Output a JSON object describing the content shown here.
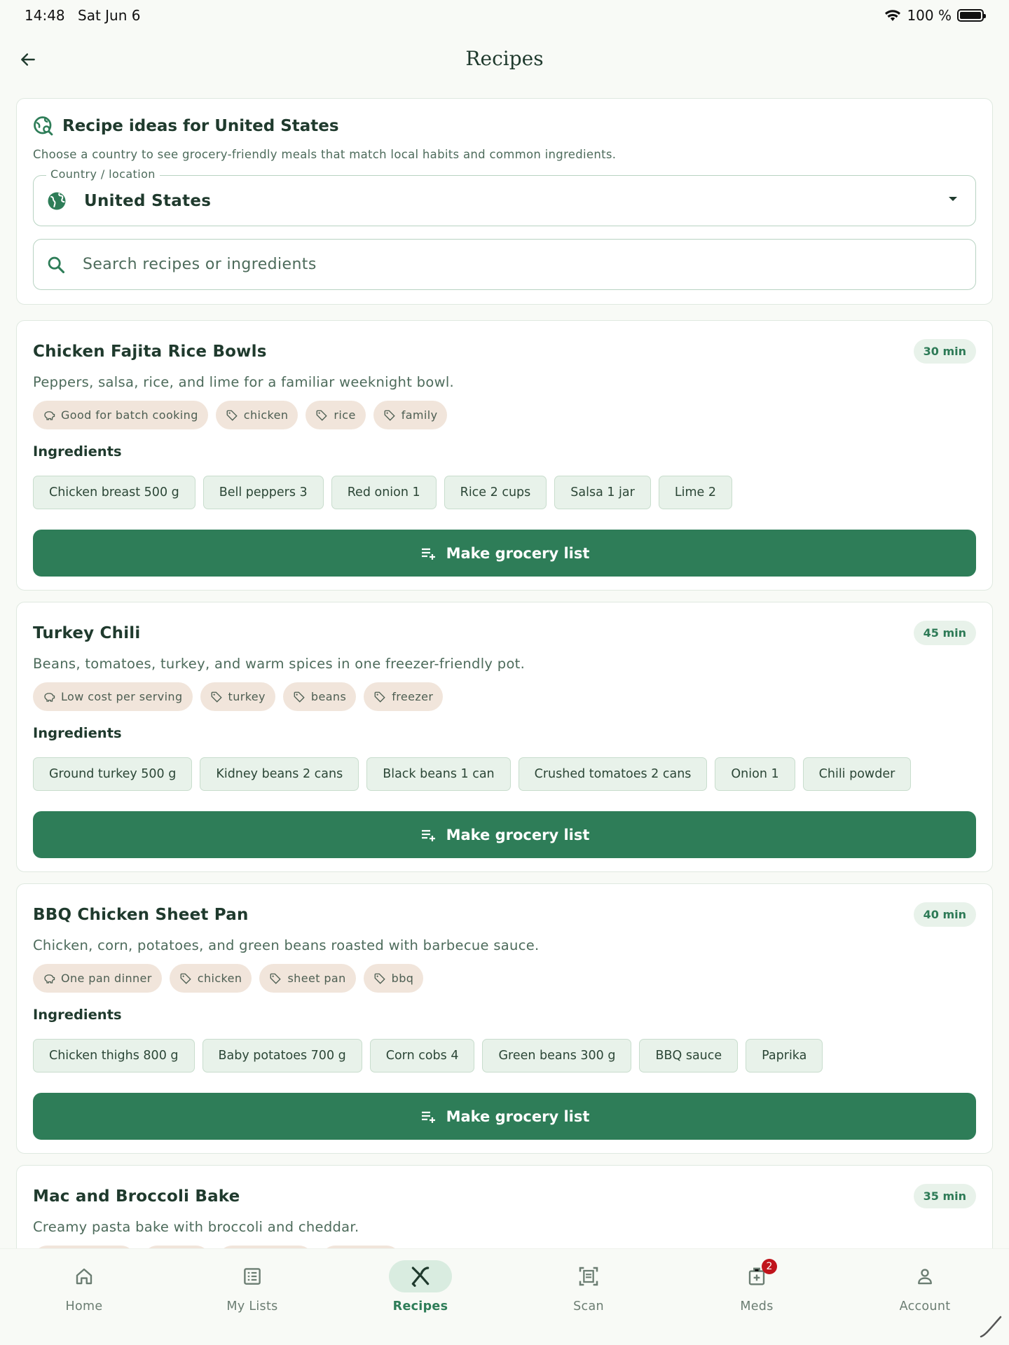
{
  "status": {
    "time": "14:48",
    "date": "Sat Jun 6",
    "battery": "100 %"
  },
  "header": {
    "title": "Recipes"
  },
  "intro": {
    "title": "Recipe ideas for United States",
    "description": "Choose a country to see grocery-friendly meals that match local habits and common ingredients.",
    "country_label": "Country / location",
    "country_value": "United States",
    "search_placeholder": "Search recipes or ingredients"
  },
  "recipes": [
    {
      "title": "Chicken Fajita Rice Bowls",
      "time": "30 min",
      "description": "Peppers, salsa, rice, and lime for a familiar weeknight bowl.",
      "highlight": "Good for batch cooking",
      "tags": [
        "chicken",
        "rice",
        "family"
      ],
      "ingredients_label": "Ingredients",
      "ingredients": [
        "Chicken breast 500 g",
        "Bell peppers 3",
        "Red onion 1",
        "Rice 2 cups",
        "Salsa 1 jar",
        "Lime 2"
      ],
      "button": "Make grocery list"
    },
    {
      "title": "Turkey Chili",
      "time": "45 min",
      "description": "Beans, tomatoes, turkey, and warm spices in one freezer-friendly pot.",
      "highlight": "Low cost per serving",
      "tags": [
        "turkey",
        "beans",
        "freezer"
      ],
      "ingredients_label": "Ingredients",
      "ingredients": [
        "Ground turkey 500 g",
        "Kidney beans 2 cans",
        "Black beans 1 can",
        "Crushed tomatoes 2 cans",
        "Onion 1",
        "Chili powder"
      ],
      "button": "Make grocery list"
    },
    {
      "title": "BBQ Chicken Sheet Pan",
      "time": "40 min",
      "description": "Chicken, corn, potatoes, and green beans roasted with barbecue sauce.",
      "highlight": "One pan dinner",
      "tags": [
        "chicken",
        "sheet pan",
        "bbq"
      ],
      "ingredients_label": "Ingredients",
      "ingredients": [
        "Chicken thighs 800 g",
        "Baby potatoes 700 g",
        "Corn cobs 4",
        "Green beans 300 g",
        "BBQ sauce",
        "Paprika"
      ],
      "button": "Make grocery list"
    },
    {
      "title": "Mac and Broccoli Bake",
      "time": "35 min",
      "description": "Creamy pasta bake with broccoli and cheddar."
    }
  ],
  "nav": {
    "home": "Home",
    "lists": "My Lists",
    "recipes": "Recipes",
    "scan": "Scan",
    "meds": "Meds",
    "meds_badge": "2",
    "account": "Account"
  },
  "colors": {
    "accent": "#2e7d58",
    "tag_bg": "#f1e5db",
    "chip_bg": "#e8f2ea",
    "badge": "#c0141c"
  }
}
